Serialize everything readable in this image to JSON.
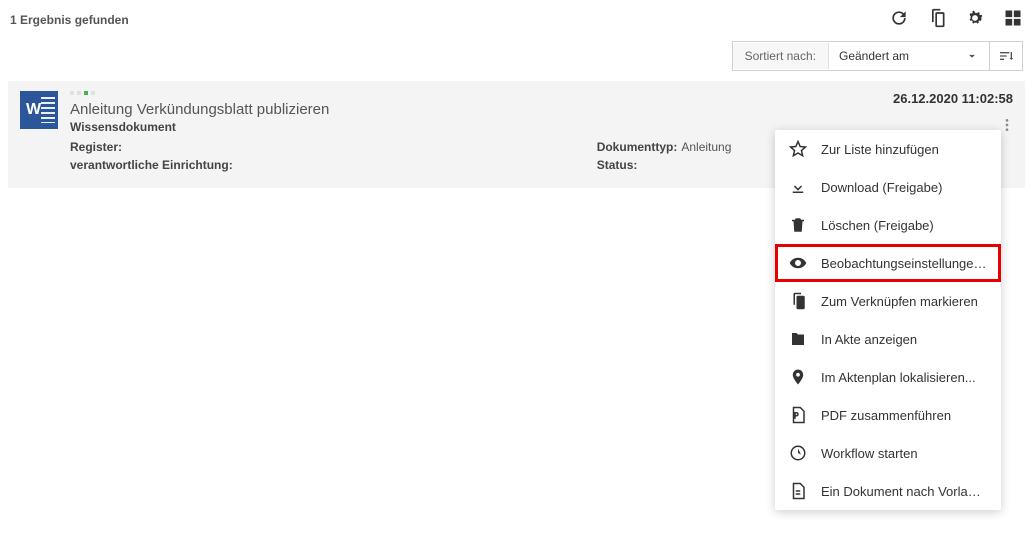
{
  "results_text": "1 Ergebnis gefunden",
  "sort": {
    "label": "Sortiert nach:",
    "value": "Geändert am"
  },
  "result": {
    "title": "Anleitung Verkündungsblatt publizieren",
    "subtype": "Wissensdokument",
    "date": "26.12.2020 11:02:58",
    "register_label": "Register:",
    "register_value": "",
    "responsible_label": "verantwortliche Einrichtung:",
    "responsible_value": "",
    "doctype_label": "Dokumenttyp:",
    "doctype_value": "Anleitung",
    "status_label": "Status:",
    "status_value": ""
  },
  "menu": {
    "add_to_list": "Zur Liste hinzufügen",
    "download": "Download (Freigabe)",
    "delete": "Löschen (Freigabe)",
    "observe_settings": "Beobachtungseinstellungen ä...",
    "mark_link": "Zum Verknüpfen markieren",
    "show_in_file": "In Akte anzeigen",
    "locate_fileplan": "Im Aktenplan lokalisieren...",
    "pdf_merge": "PDF zusammenführen",
    "start_workflow": "Workflow starten",
    "doc_from_template": "Ein Dokument nach Vorlage er..."
  }
}
